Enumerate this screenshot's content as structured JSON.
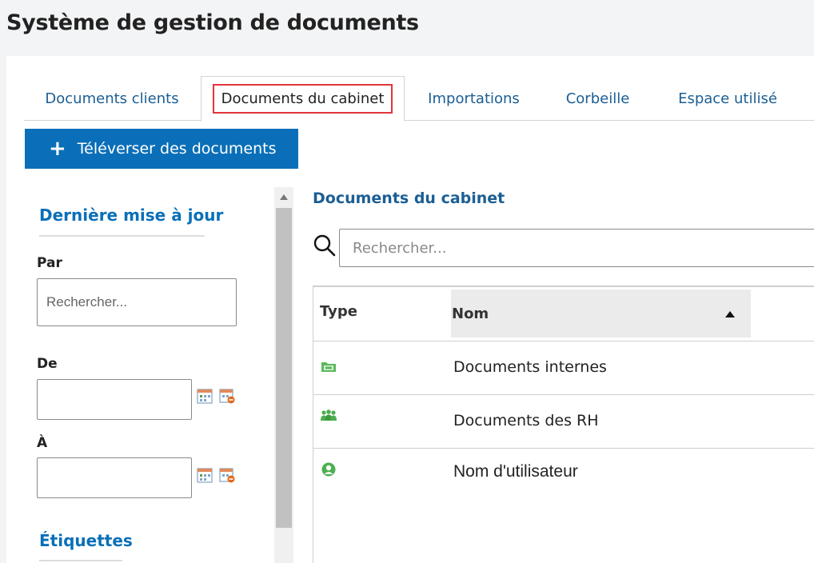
{
  "app": {
    "title": "Système de gestion de documents"
  },
  "tabs": [
    {
      "label": "Documents clients"
    },
    {
      "label": "Documents du cabinet"
    },
    {
      "label": "Importations"
    },
    {
      "label": "Corbeille"
    },
    {
      "label": "Espace utilisé"
    }
  ],
  "toolbar": {
    "upload_label": "Téléverser des documents"
  },
  "filter": {
    "last_update_title": "Dernière mise à jour",
    "by_label": "Par",
    "by_placeholder": "Rechercher...",
    "from_label": "De",
    "to_label": "À",
    "tags_title": "Étiquettes"
  },
  "content": {
    "title": "Documents du cabinet",
    "search_placeholder": "Rechercher...",
    "columns": {
      "type": "Type",
      "name": "Nom"
    },
    "rows": [
      {
        "name": "Documents internes",
        "icon": "folder-icon"
      },
      {
        "name": "Documents des RH",
        "icon": "group-icon"
      },
      {
        "name": "Nom d'utilisateur",
        "icon": "user-icon"
      }
    ]
  },
  "colors": {
    "accent": "#0a6fb8",
    "tab_text": "#1b5e94",
    "highlight": "#e2353a",
    "icon_green": "#4caf50"
  }
}
